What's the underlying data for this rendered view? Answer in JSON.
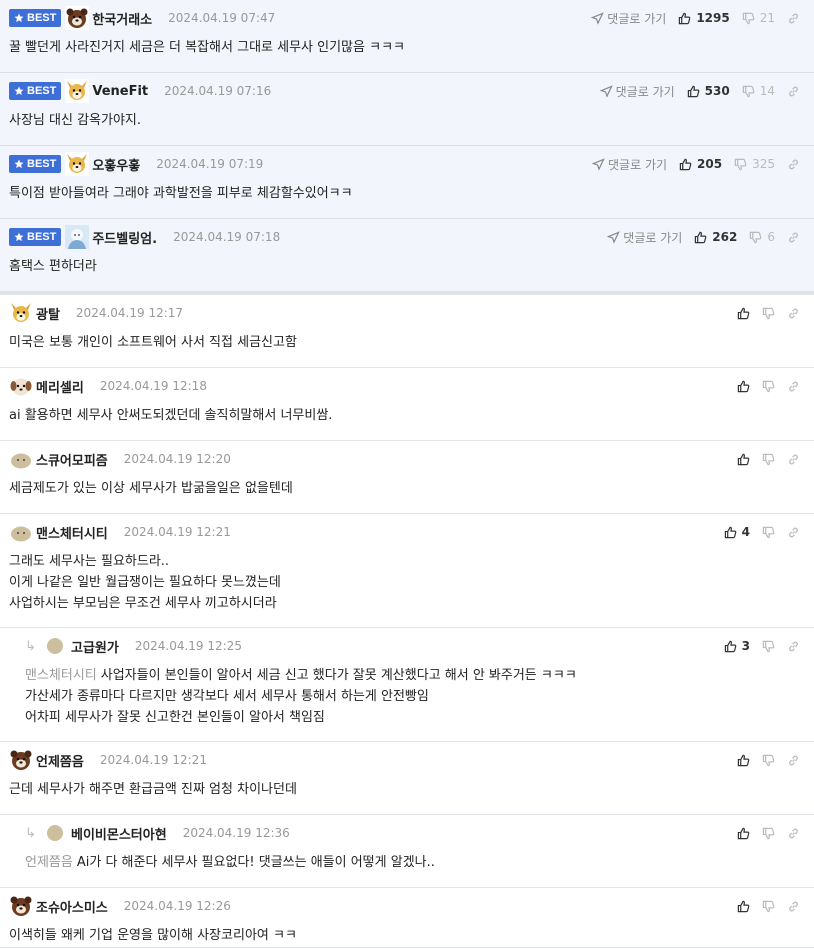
{
  "best_label": "BEST",
  "reply_link_label": "댓글로 가기",
  "best_comments": [
    {
      "nick": "한국거래소",
      "date": "2024.04.19 07:47",
      "up": "1295",
      "down": "21",
      "text": "꿀 빨던게 사라진거지 세금은 더 복잡해서 그대로 세무사 인기많음 ㅋㅋㅋ",
      "avatar": "dog-avatar-brown"
    },
    {
      "nick": "VeneFit",
      "date": "2024.04.19 07:16",
      "up": "530",
      "down": "14",
      "text": "사장님 대신 감옥가야지.",
      "avatar": "dog-avatar-yellow"
    },
    {
      "nick": "오홓우홓",
      "date": "2024.04.19 07:19",
      "up": "205",
      "down": "325",
      "text": "특이점 받아들여라 그래야 과학발전을 피부로 체감할수있어ㅋㅋ",
      "avatar": "dog-avatar-yellow"
    },
    {
      "nick": "주드벨링엄.",
      "date": "2024.04.19 07:18",
      "up": "262",
      "down": "6",
      "text": "홈택스 편하더라",
      "avatar": "person-avatar"
    }
  ],
  "comments": [
    {
      "nick": "광탈",
      "date": "2024.04.19 12:17",
      "up": "",
      "lines": [
        "미국은 보통 개인이 소프트웨어 사서 직접 세금신고함"
      ],
      "avatar": "dog-avatar-yellow"
    },
    {
      "nick": "메리셀리",
      "date": "2024.04.19 12:18",
      "up": "",
      "lines": [
        "ai 활용하면 세무사 안써도되겠던데 솔직히말해서 너무비쌈."
      ],
      "avatar": "dog-avatar-white"
    },
    {
      "nick": "스큐어모피즘",
      "date": "2024.04.19 12:20",
      "up": "",
      "lines": [
        "세금제도가 있는 이상 세무사가 밥굶을일은 없을텐데"
      ],
      "avatar": "blob-avatar"
    },
    {
      "nick": "맨스체터시티",
      "date": "2024.04.19 12:21",
      "up": "4",
      "lines": [
        "그래도 세무사는 필요하드라..",
        "이게 나같은 일반 월급쟁이는 필요하다 못느꼈는데",
        "사업하시는 부모님은 무조건 세무사 끼고하시더라"
      ],
      "avatar": "blob-avatar"
    },
    {
      "reply": true,
      "nick": "고급원가",
      "date": "2024.04.19 12:25",
      "up": "3",
      "mention": "맨스체터시티",
      "lines": [
        "사업자들이 본인들이 알아서 세금 신고 했다가 잘못 계산했다고 해서 안 봐주거든 ㅋㅋㅋ",
        "가산세가 종류마다 다르지만 생각보다 세서 세무사 통해서 하는게 안전빵임",
        "어차피 세무사가 잘못 신고한건 본인들이 알아서 책임짐"
      ],
      "avatar": "dot-avatar"
    },
    {
      "nick": "언제쯤음",
      "date": "2024.04.19 12:21",
      "up": "",
      "lines": [
        "근데 세무사가 해주면 환급금액 진짜 엄청 차이나던데"
      ],
      "avatar": "dog-avatar-brown"
    },
    {
      "reply": true,
      "nick": "베이비몬스터아현",
      "date": "2024.04.19 12:36",
      "up": "",
      "mention": "언제쯤음",
      "lines": [
        "Ai가 다 해준다 세무사 필요없다! 댓글쓰는 애들이 어떻게 알겠나.."
      ],
      "avatar": "dot-avatar"
    },
    {
      "nick": "조슈아스미스",
      "date": "2024.04.19 12:26",
      "up": "",
      "lines": [
        "이색히들 왜케 기업 운영을 많이해 사장코리아여 ㅋㅋ"
      ],
      "avatar": "dog-avatar-brown"
    }
  ],
  "colors": {
    "best_badge": "#3d6fd6",
    "best_bg": "#f2f5fb"
  }
}
